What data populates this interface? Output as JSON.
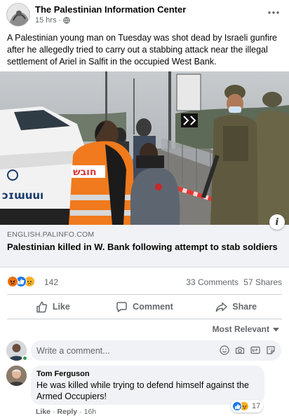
{
  "post": {
    "page_name": "The Palestinian Information Center",
    "time": "15 hrs",
    "separator": "·",
    "audience_icon": "globe-icon",
    "more_icon": "more-options-icon",
    "text": "A Palestinian young man on Tuesday was shot dead by Israeli gunfire after he allegedly tried to carry out a stabbing attack near the illegal settlement of Ariel in Salfit in the occupied West Bank."
  },
  "image": {
    "vest_text": "חובש",
    "car_text": "ɔɪɯuuı"
  },
  "link": {
    "domain": "ENGLISH.PALINFO.COM",
    "title": "Palestinian killed in W. Bank following attempt to stab soldiers",
    "info_icon": "i"
  },
  "stats": {
    "reaction_icons": [
      "angry-reaction-icon",
      "like-reaction-icon",
      "sad-reaction-icon"
    ],
    "reaction_count": "142",
    "comments": "33 Comments",
    "shares": "57 Shares"
  },
  "actions": {
    "like": "Like",
    "comment": "Comment",
    "share": "Share"
  },
  "comments_section": {
    "sort_label": "Most Relevant",
    "composer_placeholder": "Write a comment...",
    "composer_icons": [
      "emoji-icon",
      "camera-icon",
      "gif-icon",
      "sticker-icon"
    ],
    "comment": {
      "author": "Tom Ferguson",
      "text": "He was killed while trying to defend himself against the Armed Occupiers!",
      "reaction_count": "17",
      "like": "Like",
      "dot": "·",
      "reply": "Reply",
      "time": "16h"
    }
  },
  "colors": {
    "secondary_text": "#65676b",
    "bubble": "#f0f2f5",
    "like_blue": "#1877f2",
    "angry_orange": "#e9710f",
    "sad_yellow": "#f7b125",
    "online_green": "#31a24c"
  }
}
